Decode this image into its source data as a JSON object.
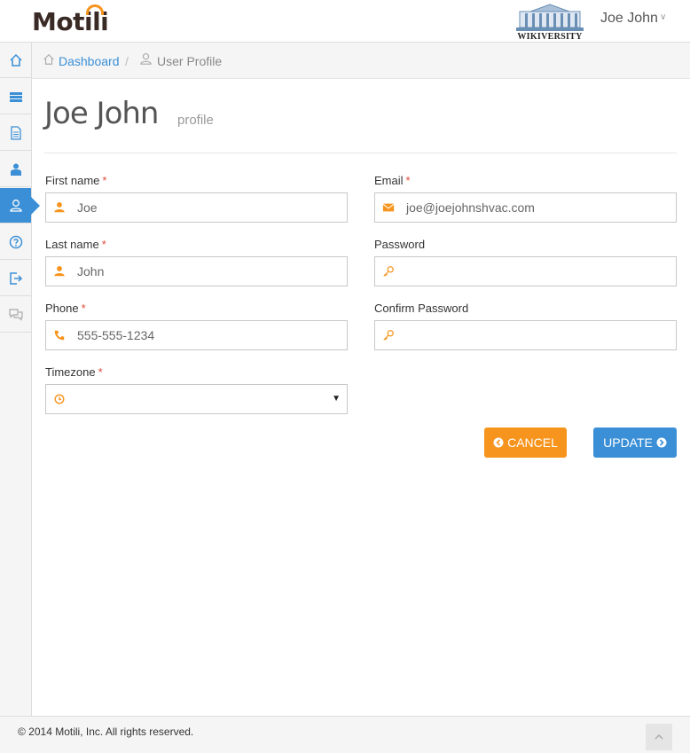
{
  "header": {
    "logo_text": "Motili",
    "partner_logo_text": "WIKIVERSITY",
    "user_name": "Joe John",
    "user_caret_icon": "chevron-down-icon"
  },
  "sidebar": {
    "items": [
      {
        "icon": "home-icon",
        "active": false
      },
      {
        "icon": "list-icon",
        "active": false
      },
      {
        "icon": "document-icon",
        "active": false
      },
      {
        "icon": "contractor-icon",
        "active": false
      },
      {
        "icon": "user-icon",
        "active": true
      },
      {
        "icon": "help-icon",
        "active": false
      },
      {
        "icon": "logout-icon",
        "active": false
      },
      {
        "icon": "chat-icon",
        "active": false
      }
    ]
  },
  "breadcrumb": {
    "home_label": "Dashboard",
    "separator": "/",
    "current_label": "User Profile"
  },
  "page": {
    "title": "Joe John",
    "subtitle": "profile"
  },
  "form": {
    "first_name": {
      "label": "First name",
      "required": "*",
      "value": "Joe",
      "icon": "user-icon"
    },
    "last_name": {
      "label": "Last name",
      "required": "*",
      "value": "John",
      "icon": "user-icon"
    },
    "phone": {
      "label": "Phone",
      "required": "*",
      "value": "555-555-1234",
      "icon": "phone-icon"
    },
    "timezone": {
      "label": "Timezone",
      "required": "*",
      "value": "",
      "icon": "clock-icon"
    },
    "email": {
      "label": "Email",
      "required": "*",
      "value": "joe@joejohnshvac.com",
      "icon": "envelope-icon"
    },
    "password": {
      "label": "Password",
      "value": "",
      "icon": "key-icon"
    },
    "confirm_password": {
      "label": "Confirm Password",
      "value": "",
      "icon": "key-icon"
    },
    "cancel_label": "CANCEL",
    "update_label": "UPDATE"
  },
  "footer": {
    "copyright": "© 2014 Motili, Inc. All rights reserved."
  },
  "colors": {
    "accent_blue": "#3a8fd6",
    "accent_orange": "#f7941d",
    "required_red": "#e04b3a"
  }
}
